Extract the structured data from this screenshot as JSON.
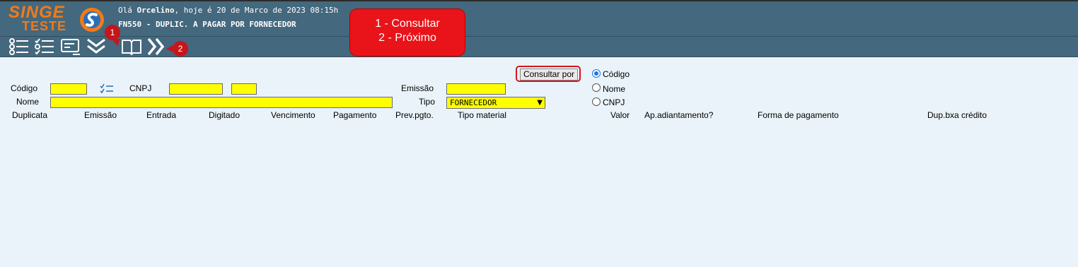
{
  "header": {
    "logo_main": "SINGE",
    "logo_sub": "TESTE",
    "greeting_prefix": "Olá ",
    "user": "Orcelino",
    "greeting_suffix": ", hoje é 20 de Marco de 2023 08:15h",
    "module_title": "FN550 - DUPLIC. A PAGAR POR FORNECEDOR"
  },
  "toolbar": {
    "icons": [
      "list-icon",
      "checklist-icon",
      "card-icon",
      "double-chevron-down-icon",
      "book-icon",
      "double-chevron-right-icon"
    ]
  },
  "callout": {
    "line1": "1 - Consultar",
    "line2": "2 - Próximo"
  },
  "badges": {
    "one": "1",
    "two": "2"
  },
  "form": {
    "codigo_label": "Código",
    "codigo_value": "",
    "cnpj_label": "CNPJ",
    "cnpj_value": "",
    "cnpj_suffix_value": "",
    "nome_label": "Nome",
    "nome_value": "",
    "emissao_label": "Emissão",
    "emissao_value": "",
    "tipo_label": "Tipo",
    "tipo_value": "FORNECEDOR",
    "consultar_por_label": "Consultar por",
    "radio_options": [
      {
        "label": "Código",
        "checked": true
      },
      {
        "label": "Nome",
        "checked": false
      },
      {
        "label": "CNPJ",
        "checked": false
      }
    ]
  },
  "table": {
    "headers": [
      "Duplicata",
      "Emissão",
      "Entrada",
      "Digitado",
      "Vencimento",
      "Pagamento",
      "Prev.pgto.",
      "Tipo material",
      "Valor",
      "Ap.adiantamento?",
      "Forma de pagamento",
      "Dup.bxa crédito"
    ]
  },
  "colors": {
    "header_bg": "#44687d",
    "page_bg": "#eaf3f9",
    "input_bg": "#ffff00",
    "accent_red": "#e8141a",
    "logo_orange": "#f27a1a"
  }
}
